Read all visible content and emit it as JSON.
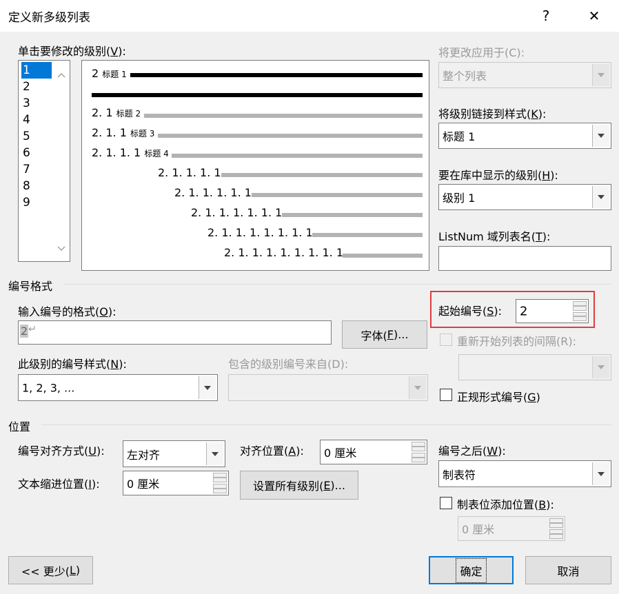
{
  "dialog": {
    "title": "定义新多级列表",
    "help_glyph": "?",
    "close_glyph": "✕"
  },
  "levels": {
    "label": "单击要修改的级别(",
    "hotkey": "V",
    "label_end": "):",
    "items": [
      "1",
      "2",
      "3",
      "4",
      "5",
      "6",
      "7",
      "8",
      "9"
    ],
    "selected": "1"
  },
  "preview": {
    "row1_num": "2",
    "row1_style": "标题 1",
    "row3_num": "2. 1",
    "row3_style": "标题 2",
    "row4_num": "2. 1. 1",
    "row4_style": "标题 3",
    "row5_num": "2. 1. 1. 1",
    "row5_style": "标题 4",
    "row6_num": "2. 1. 1. 1. 1",
    "row7_num": "2. 1. 1. 1. 1. 1",
    "row8_num": "2. 1. 1. 1. 1. 1. 1",
    "row9_num": "2. 1. 1. 1. 1. 1. 1. 1",
    "row10_num": "2. 1. 1. 1. 1. 1. 1. 1. 1"
  },
  "apply_to": {
    "label": "将更改应用于(C):",
    "value": "整个列表"
  },
  "link_style": {
    "label": "将级别链接到样式(",
    "hotkey": "K",
    "label_end": "):",
    "value": "标题 1"
  },
  "gallery_level": {
    "label": "要在库中显示的级别(",
    "hotkey": "H",
    "label_end": "):",
    "value": "级别 1"
  },
  "listnum": {
    "label": "ListNum 域列表名(",
    "hotkey": "T",
    "label_end": "):",
    "value": ""
  },
  "number_format": {
    "group_label": "编号格式",
    "format_label": "输入编号的格式(",
    "format_hotkey": "O",
    "format_label_end": "):",
    "format_value": "2",
    "format_mark": "↵",
    "font_button": "字体(",
    "font_hotkey": "F",
    "font_button_end": ")...",
    "style_label": "此级别的编号样式(",
    "style_hotkey": "N",
    "style_label_end": "):",
    "style_value": "1, 2, 3, ...",
    "include_label": "包含的级别编号来自(D):",
    "include_value": ""
  },
  "start_at": {
    "label": "起始编号(",
    "hotkey": "S",
    "label_end": "):",
    "value": "2"
  },
  "restart": {
    "label": "重新开始列表的间隔(R):",
    "value": "",
    "checked": false
  },
  "legal": {
    "label": "正规形式编号(",
    "hotkey": "G",
    "label_end": ")",
    "checked": false
  },
  "position": {
    "group_label": "位置",
    "align_label": "编号对齐方式(",
    "align_hotkey": "U",
    "align_label_end": "):",
    "align_value": "左对齐",
    "at_label": "对齐位置(",
    "at_hotkey": "A",
    "at_label_end": "):",
    "at_value": "0 厘米",
    "indent_label": "文本缩进位置(",
    "indent_hotkey": "I",
    "indent_label_end": "):",
    "indent_value": "0 厘米",
    "set_all_button": "设置所有级别(",
    "set_all_hotkey": "E",
    "set_all_button_end": ")...",
    "follow_label": "编号之后(",
    "follow_hotkey": "W",
    "follow_label_end": "):",
    "follow_value": "制表符",
    "tabstop_label": "制表位添加位置(",
    "tabstop_hotkey": "B",
    "tabstop_label_end": "):",
    "tabstop_checked": false,
    "tabstop_value": "0 厘米"
  },
  "footer": {
    "less_button": "<< 更少(",
    "less_hotkey": "L",
    "less_button_end": ")",
    "ok_button": "确定",
    "cancel_button": "取消"
  },
  "colors": {
    "highlight_border": "#e03c3c",
    "selection": "#0078d7",
    "dialog_bg": "#f0f0f0"
  }
}
